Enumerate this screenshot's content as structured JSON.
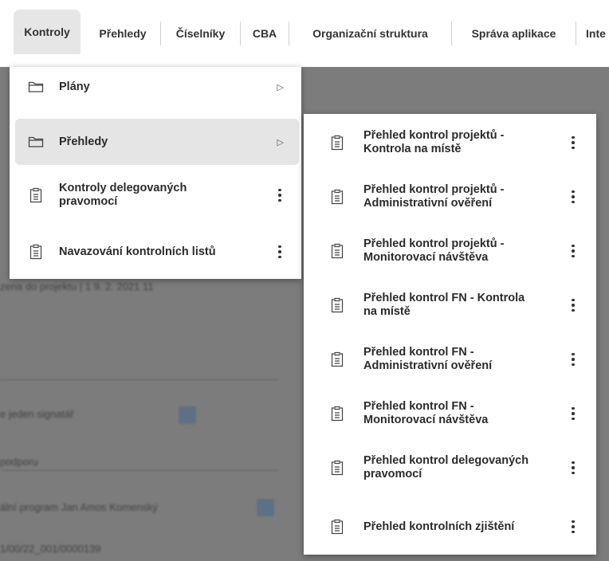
{
  "nav": {
    "tabs": [
      {
        "label": "Kontroly"
      },
      {
        "label": "Přehledy"
      },
      {
        "label": "Číselníky"
      },
      {
        "label": "CBA"
      },
      {
        "label": "Organizační struktura"
      },
      {
        "label": "Správa aplikace"
      },
      {
        "label": "Inte"
      }
    ]
  },
  "menu": {
    "items": [
      {
        "label": "Plány",
        "icon": "folder-icon"
      },
      {
        "label": "Přehledy",
        "icon": "folder-icon"
      },
      {
        "label": "Kontroly delegovaných\npravomocí",
        "icon": "clipboard-icon"
      },
      {
        "label": "Navazování kontrolních listů",
        "icon": "clipboard-icon"
      }
    ]
  },
  "submenu": {
    "items": [
      {
        "label": "Přehled kontrol projektů -\nKontrola na místě"
      },
      {
        "label": "Přehled kontrol projektů -\nAdministrativní ověření"
      },
      {
        "label": "Přehled kontrol projektů -\nMonitorovací návštěva"
      },
      {
        "label": "Přehled kontrol FN - Kontrola\nna místě"
      },
      {
        "label": "Přehled kontrol FN -\nAdministrativní ověření"
      },
      {
        "label": "Přehled kontrol FN -\nMonitorovací návštěva"
      },
      {
        "label": "Přehled kontrol delegovaných\npravomocí"
      },
      {
        "label": "Přehled kontrolních zjištění"
      }
    ]
  },
  "background": {
    "texts": [
      "zena do projektu | 1 9. 2. 2021 11",
      "e jeden signatář",
      "podporu",
      "ální program Jan Amos Komenský",
      "1/00/22_001/0000139"
    ]
  },
  "colors": {
    "active_tab": "#e6e6e6",
    "backdrop": "#7c7c7c",
    "highlight": "#e5e5e5"
  }
}
